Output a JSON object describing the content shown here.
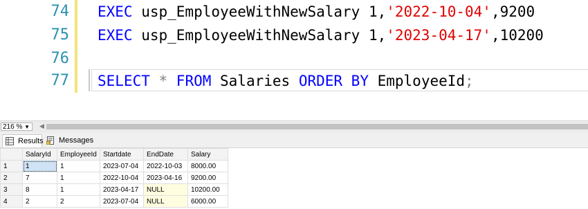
{
  "editor": {
    "lines": [
      {
        "num": "74",
        "kw": "EXEC",
        "proc": " usp_EmployeeWithNewSalary 1,",
        "date": "'2022-10-04'",
        "rest": ",9200"
      },
      {
        "num": "75",
        "kw": "EXEC",
        "proc": " usp_EmployeeWithNewSalary 1,",
        "date": "'2023-04-17'",
        "rest": ",10200"
      },
      {
        "num": "76"
      },
      {
        "num": "77",
        "select": "SELECT",
        "star": " * ",
        "from": "FROM",
        "table": " Salaries ",
        "order": "ORDER BY",
        "col": " EmployeeId",
        "semi": ";"
      }
    ]
  },
  "zoom": {
    "value": "216 %"
  },
  "tabs": [
    {
      "label": "Results",
      "icon": "results-grid-icon"
    },
    {
      "label": "Messages",
      "icon": "messages-icon"
    }
  ],
  "results": {
    "columns": [
      "SalaryId",
      "EmployeeId",
      "Startdate",
      "EndDate",
      "Salary"
    ],
    "rows": [
      {
        "rn": "1",
        "cells": [
          "1",
          "1",
          "2023-07-04",
          "2022-10-03",
          "8000.00"
        ]
      },
      {
        "rn": "2",
        "cells": [
          "7",
          "1",
          "2022-10-04",
          "2023-04-16",
          "9200.00"
        ]
      },
      {
        "rn": "3",
        "cells": [
          "8",
          "1",
          "2023-04-17",
          "NULL",
          "10200.00"
        ]
      },
      {
        "rn": "4",
        "cells": [
          "2",
          "2",
          "2023-07-04",
          "NULL",
          "6000.00"
        ]
      }
    ]
  },
  "colors": {
    "keyword": "#0000ff",
    "string": "#e00000",
    "line_number": "#2b91af",
    "null_cell": "#fffde0",
    "selected_cell": "#cfe3f5"
  }
}
